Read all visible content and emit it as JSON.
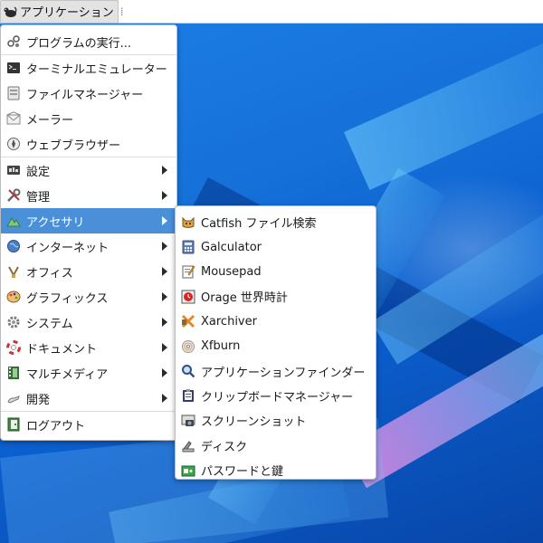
{
  "panel": {
    "app_menu_label": "アプリケーション"
  },
  "main_menu": {
    "items": [
      {
        "label": "プログラムの実行...",
        "icon": "run-icon"
      },
      {
        "label": "ターミナルエミュレーター",
        "icon": "terminal-icon"
      },
      {
        "label": "ファイルマネージャー",
        "icon": "file-manager-icon"
      },
      {
        "label": "メーラー",
        "icon": "mail-icon"
      },
      {
        "label": "ウェブブラウザー",
        "icon": "web-browser-icon"
      },
      {
        "label": "設定",
        "icon": "settings-icon",
        "submenu": true
      },
      {
        "label": "管理",
        "icon": "admin-tools-icon",
        "submenu": true
      },
      {
        "label": "アクセサリ",
        "icon": "accessories-icon",
        "submenu": true,
        "active": true
      },
      {
        "label": "インターネット",
        "icon": "internet-globe-icon",
        "submenu": true
      },
      {
        "label": "オフィス",
        "icon": "office-icon",
        "submenu": true
      },
      {
        "label": "グラフィックス",
        "icon": "graphics-palette-icon",
        "submenu": true
      },
      {
        "label": "システム",
        "icon": "system-gear-icon",
        "submenu": true
      },
      {
        "label": "ドキュメント",
        "icon": "help-lifebuoy-icon",
        "submenu": true
      },
      {
        "label": "マルチメディア",
        "icon": "multimedia-film-icon",
        "submenu": true
      },
      {
        "label": "開発",
        "icon": "development-icon",
        "submenu": true
      },
      {
        "label": "ログアウト",
        "icon": "logout-icon"
      }
    ]
  },
  "sub_menu": {
    "items": [
      {
        "label": "Catfish ファイル検索",
        "icon": "catfish-icon"
      },
      {
        "label": "Galculator",
        "icon": "calculator-icon"
      },
      {
        "label": "Mousepad",
        "icon": "text-editor-icon"
      },
      {
        "label": "Orage 世界時計",
        "icon": "clock-icon"
      },
      {
        "label": "Xarchiver",
        "icon": "archive-icon"
      },
      {
        "label": "Xfburn",
        "icon": "disc-burner-icon"
      },
      {
        "label": "アプリケーションファインダー",
        "icon": "app-finder-icon"
      },
      {
        "label": "クリップボードマネージャー",
        "icon": "clipboard-icon"
      },
      {
        "label": "スクリーンショット",
        "icon": "screenshot-camera-icon"
      },
      {
        "label": "ディスク",
        "icon": "disk-utility-icon"
      },
      {
        "label": "パスワードと鍵",
        "icon": "password-keys-icon"
      }
    ]
  }
}
